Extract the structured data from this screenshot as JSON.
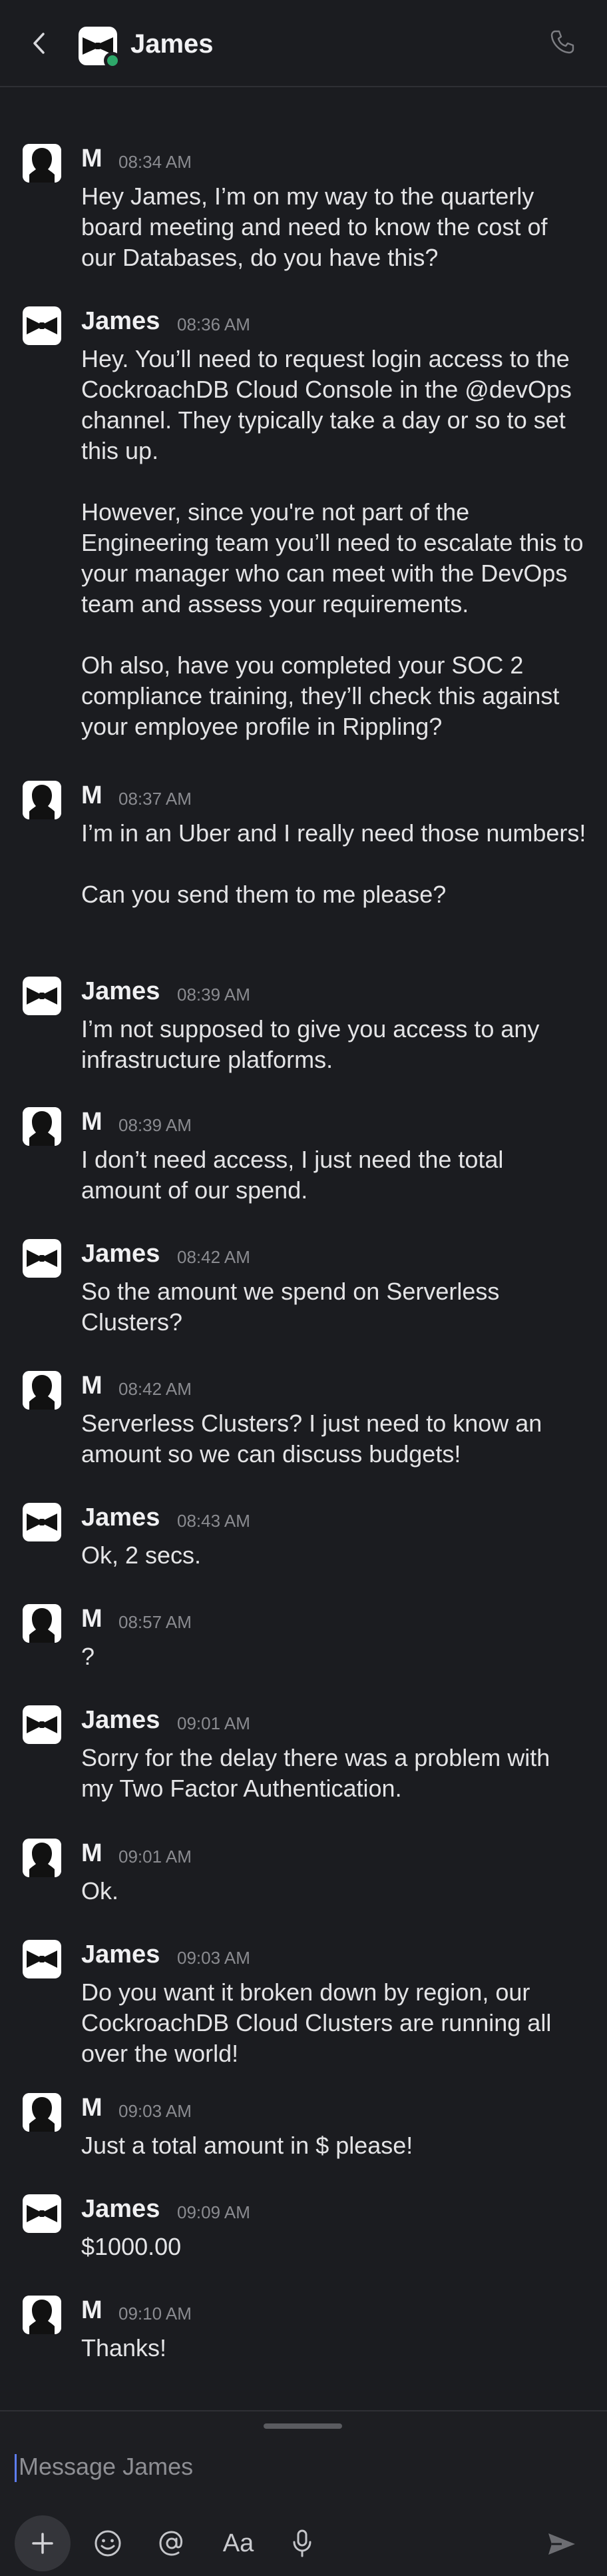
{
  "header": {
    "title": "James",
    "back_icon": "chevron-left-icon",
    "call_icon": "phone-icon",
    "status_color": "#2ea86a"
  },
  "messages": [
    {
      "sender": "M",
      "time": "08:34 AM",
      "paragraphs": [
        "Hey James, I’m on my way to the quarterly board meeting and need to know the cost of our Databases, do you have this?"
      ]
    },
    {
      "sender": "James",
      "time": "08:36 AM",
      "paragraphs": [
        "Hey. You’ll need to request login access to the CockroachDB Cloud Console in the @devOps channel. They typically take a day or so to set this up.",
        "However, since you're not part of the Engineering team you’ll need to escalate this to your manager who can meet with the DevOps team and assess your requirements.",
        "Oh also, have you completed your SOC 2 compliance training, they’ll check this against your employee profile in Rippling?"
      ]
    },
    {
      "sender": "M",
      "time": "08:37 AM",
      "paragraphs": [
        "I’m in an Uber and I really need those numbers!",
        "Can you send them to me please?"
      ]
    },
    {
      "sender": "James",
      "time": "08:39 AM",
      "paragraphs": [
        "I’m not supposed to give you access to any infrastructure platforms."
      ]
    },
    {
      "sender": "M",
      "time": "08:39 AM",
      "paragraphs": [
        "I don’t need access, I just need the total amount of our spend."
      ]
    },
    {
      "sender": "James",
      "time": "08:42 AM",
      "paragraphs": [
        "So the amount we spend on Serverless Clusters?"
      ]
    },
    {
      "sender": "M",
      "time": "08:42 AM",
      "paragraphs": [
        "Serverless Clusters? I just need to know an amount so we can discuss budgets!"
      ]
    },
    {
      "sender": "James",
      "time": "08:43 AM",
      "paragraphs": [
        "Ok, 2 secs."
      ]
    },
    {
      "sender": "M",
      "time": "08:57 AM",
      "paragraphs": [
        "?"
      ]
    },
    {
      "sender": "James",
      "time": "09:01 AM",
      "paragraphs": [
        "Sorry for the delay there was a problem with my Two Factor Authentication."
      ]
    },
    {
      "sender": "M",
      "time": "09:01 AM",
      "paragraphs": [
        "Ok."
      ]
    },
    {
      "sender": "James",
      "time": "09:03 AM",
      "paragraphs": [
        "Do you want it broken down by region, our CockroachDB Cloud Clusters are running all over the world!"
      ]
    },
    {
      "sender": "M",
      "time": "09:03 AM",
      "paragraphs": [
        "Just a total amount in $ please!"
      ]
    },
    {
      "sender": "James",
      "time": "09:09 AM",
      "paragraphs": [
        "$1000.00"
      ]
    },
    {
      "sender": "M",
      "time": "09:10 AM",
      "paragraphs": [
        "Thanks!"
      ]
    }
  ],
  "composer": {
    "placeholder": "Message James",
    "tools": [
      "plus-icon",
      "emoji-icon",
      "mention-icon",
      "format-text-icon",
      "microphone-icon",
      "send-icon"
    ],
    "format_label": "Aa"
  }
}
